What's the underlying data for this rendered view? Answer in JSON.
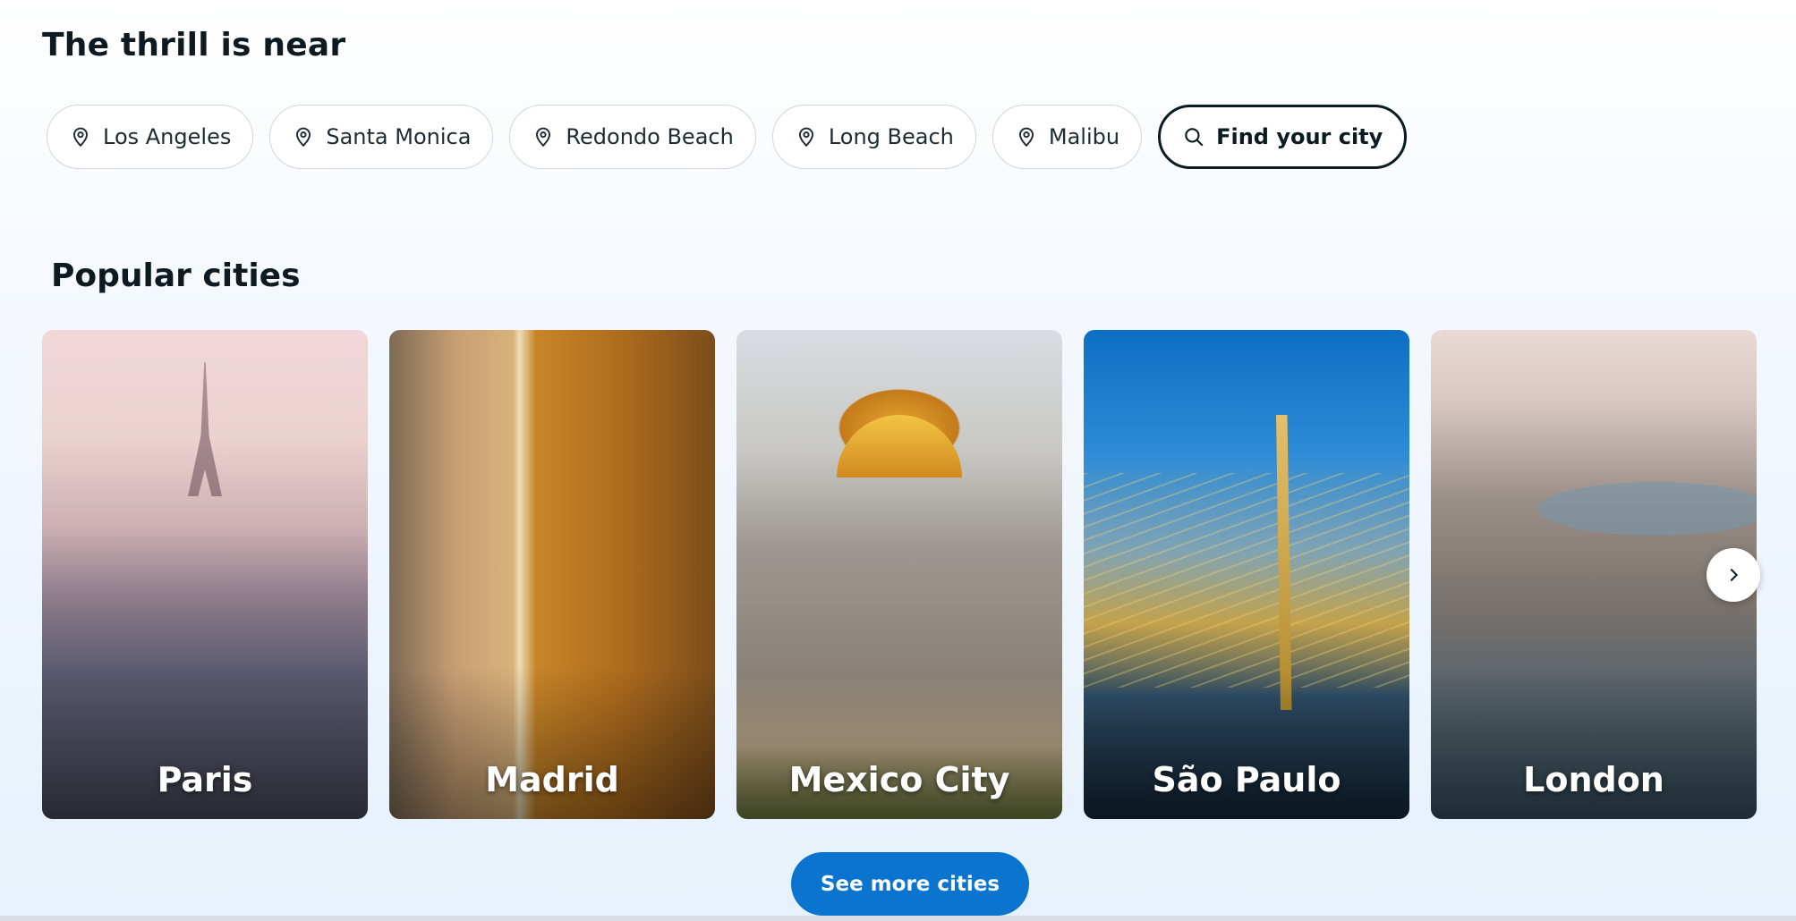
{
  "near": {
    "title": "The thrill is near",
    "chips": [
      {
        "label": "Los Angeles",
        "icon": "location-pin-icon"
      },
      {
        "label": "Santa Monica",
        "icon": "location-pin-icon"
      },
      {
        "label": "Redondo Beach",
        "icon": "location-pin-icon"
      },
      {
        "label": "Long Beach",
        "icon": "location-pin-icon"
      },
      {
        "label": "Malibu",
        "icon": "location-pin-icon"
      }
    ],
    "find_city": {
      "label": "Find your city",
      "icon": "search-icon"
    }
  },
  "popular": {
    "title": "Popular cities",
    "cities": [
      {
        "name": "Paris"
      },
      {
        "name": "Madrid"
      },
      {
        "name": "Mexico City"
      },
      {
        "name": "São Paulo"
      },
      {
        "name": "London"
      }
    ],
    "next_icon": "chevron-right-icon",
    "see_more_label": "See more cities"
  },
  "colors": {
    "primary": "#0a74cf",
    "text": "#0b1b24",
    "chip_border": "#cfd6dc"
  }
}
